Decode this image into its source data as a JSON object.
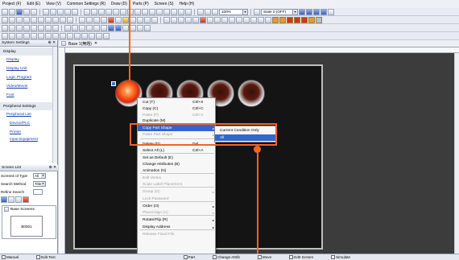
{
  "menu": [
    "Project (F)",
    "Edit (E)",
    "View (V)",
    "Common Settings (R)",
    "Draw (D)",
    "Parts (P)",
    "Screen (S)",
    "Help (H)"
  ],
  "toolbar": {
    "zoom": "100%",
    "state": "State 0 (OFF)"
  },
  "left_pane": {
    "title": "System Settings",
    "display_section": "Display",
    "display_links": [
      "Display",
      "Display Unit",
      "Logic Program",
      "Video/Movie",
      "Font"
    ],
    "peripheral_section": "Peripheral Settings",
    "peripheral_links": [
      "Peripheral List",
      "Device/PLC",
      "Printer",
      "Input Equipment"
    ],
    "screen_list": {
      "title": "Screen List",
      "type_label": "Screens of Type",
      "type_value": "All",
      "search_label": "Search Method",
      "search_value": "Title",
      "refine_label": "Refine Search",
      "base_label": "Base Screens",
      "screen_number": "B0001"
    }
  },
  "editor": {
    "tab_label": "Base 1(無題)"
  },
  "context_menu": {
    "items": [
      {
        "label": "Cut (T)",
        "shortcut": "Ctrl+X",
        "enabled": true
      },
      {
        "label": "Copy (C)",
        "shortcut": "Ctrl+C",
        "enabled": true
      },
      {
        "label": "Paste (P)",
        "shortcut": "Ctrl+V",
        "enabled": false
      },
      {
        "label": "Duplicate (M)",
        "shortcut": "",
        "enabled": true
      },
      {
        "label": "Copy Part Shape",
        "shortcut": "",
        "enabled": true
      },
      {
        "label": "Paste Part Shape",
        "shortcut": "",
        "enabled": false
      },
      {
        "label": "Delete (D)",
        "shortcut": "Del",
        "enabled": true
      },
      {
        "label": "Select All (L)",
        "shortcut": "Ctrl+A",
        "enabled": true
      },
      {
        "label": "Set as Default (E)",
        "shortcut": "",
        "enabled": true
      },
      {
        "label": "Change Attributes (B)",
        "shortcut": "",
        "enabled": true
      },
      {
        "label": "Animation (N)",
        "shortcut": "",
        "enabled": true
      },
      {
        "label": "Edit Vertex",
        "shortcut": "",
        "enabled": false
      },
      {
        "label": "Scale Label Placement",
        "shortcut": "",
        "enabled": false
      },
      {
        "label": "Group (G)",
        "shortcut": "",
        "enabled": false
      },
      {
        "label": "Lock Password",
        "shortcut": "",
        "enabled": false
      },
      {
        "label": "Order (O)",
        "shortcut": "",
        "enabled": true
      },
      {
        "label": "Place/Align (A)",
        "shortcut": "",
        "enabled": false
      },
      {
        "label": "Rotate/Flip (R)",
        "shortcut": "",
        "enabled": true
      },
      {
        "label": "Display Address",
        "shortcut": "",
        "enabled": true
      },
      {
        "label": "Release Fixed File",
        "shortcut": "",
        "enabled": false
      }
    ],
    "submenu": [
      "Current Condition Only",
      "All"
    ]
  },
  "status_bar": [
    "Manual",
    "Edit Text",
    "Part",
    "Change Attrib",
    "Move",
    "EdIt Screen",
    "Simulate"
  ]
}
